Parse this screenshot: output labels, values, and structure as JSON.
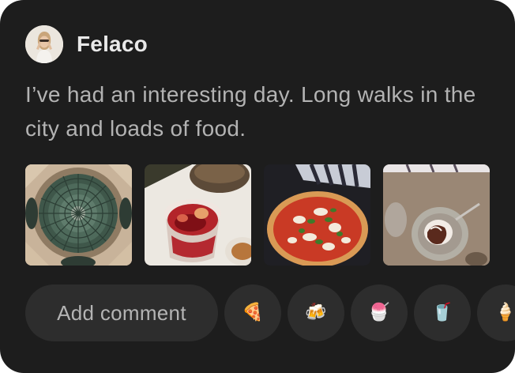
{
  "post": {
    "author": "Felaco",
    "text": "I’ve had an interesting day. Long walks in the city and loads of food.",
    "photos": [
      {
        "name": "photo-glass-dome"
      },
      {
        "name": "photo-red-drink"
      },
      {
        "name": "photo-pizza"
      },
      {
        "name": "photo-dessert"
      }
    ]
  },
  "actions": {
    "comment_label": "Add comment",
    "reactions": [
      {
        "name": "pizza-emoji",
        "glyph": "🍕"
      },
      {
        "name": "beer-mugs-emoji",
        "glyph": "🍻"
      },
      {
        "name": "shaved-ice-emoji",
        "glyph": "🍧"
      },
      {
        "name": "cup-with-straw-emoji",
        "glyph": "🥤"
      },
      {
        "name": "ice-cream-emoji",
        "glyph": "🍦"
      }
    ]
  },
  "colors": {
    "card_bg": "#1d1d1d",
    "button_bg": "#2d2d2d",
    "author_text": "#e9e9e9",
    "body_text": "#b3b3b3"
  }
}
